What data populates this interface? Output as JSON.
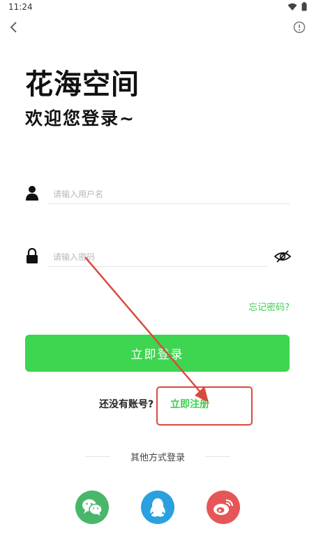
{
  "status_bar": {
    "time": "11:24"
  },
  "app": {
    "title": "花海空间",
    "welcome": "欢迎您登录~"
  },
  "form": {
    "username_placeholder": "请输入用户名",
    "password_placeholder": "请输入密码",
    "forgot_label": "忘记密码?",
    "login_label": "立即登录"
  },
  "register": {
    "prompt": "还没有账号?",
    "link": "立即注册"
  },
  "other_login": {
    "label": "其他方式登录",
    "providers": [
      "wechat-icon",
      "qq-icon",
      "weibo-icon"
    ]
  },
  "colors": {
    "accent": "#3ed551",
    "wechat": "#49b66a",
    "qq": "#2aa0df",
    "weibo": "#e65657",
    "annotation": "#d94a3e"
  }
}
